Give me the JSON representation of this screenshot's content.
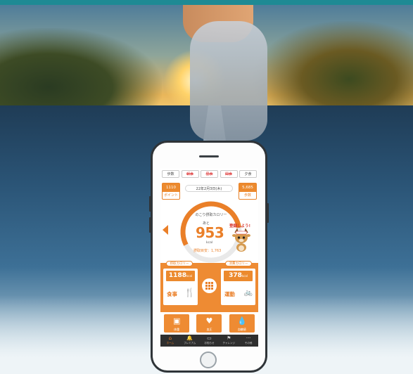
{
  "colors": {
    "accent": "#ea7f28",
    "header_bar": "#1e8a94",
    "navbar": "#2e2e2e"
  },
  "app": {
    "meal_tabs": [
      "歩数",
      "朝食",
      "昼食",
      "間食",
      "夕食"
    ],
    "date": "22年2月3日(木)",
    "points": {
      "value": "1110",
      "label": "ポイント"
    },
    "steps": {
      "value": "5,685",
      "label": "歩数"
    },
    "gauge": {
      "title": "のこり摂取カロリー",
      "prefix": "あと",
      "value": "953",
      "unit": "kcal",
      "goal": "摂取目安：1,763",
      "fill_fraction": 0.55
    },
    "mascot": {
      "speech": "登録しよう!"
    },
    "intake": {
      "pill": "摂取カロリー",
      "value": "1188",
      "unit": "kcal",
      "label": "食事",
      "icon": "fork-knife-icon"
    },
    "burned": {
      "pill": "消費カロリー",
      "value": "378",
      "unit": "kcal",
      "label": "運動",
      "icon": "bicycle-icon"
    },
    "tiles": [
      {
        "label": "体重",
        "icon": "scale-icon",
        "glyph": "▣"
      },
      {
        "label": "血圧",
        "icon": "heart-pulse-icon",
        "glyph": "♥"
      },
      {
        "label": "血糖値",
        "icon": "drop-icon",
        "glyph": "💧"
      }
    ],
    "nav": [
      {
        "label": "ホーム",
        "icon": "home-icon",
        "glyph": "⌂"
      },
      {
        "label": "プレミアム",
        "icon": "bell-icon",
        "glyph": "🔔"
      },
      {
        "label": "お知らせ",
        "icon": "message-icon",
        "glyph": "▭"
      },
      {
        "label": "チャレンジ",
        "icon": "flag-icon",
        "glyph": "⚑"
      },
      {
        "label": "その他",
        "icon": "more-icon",
        "glyph": "···"
      }
    ]
  }
}
